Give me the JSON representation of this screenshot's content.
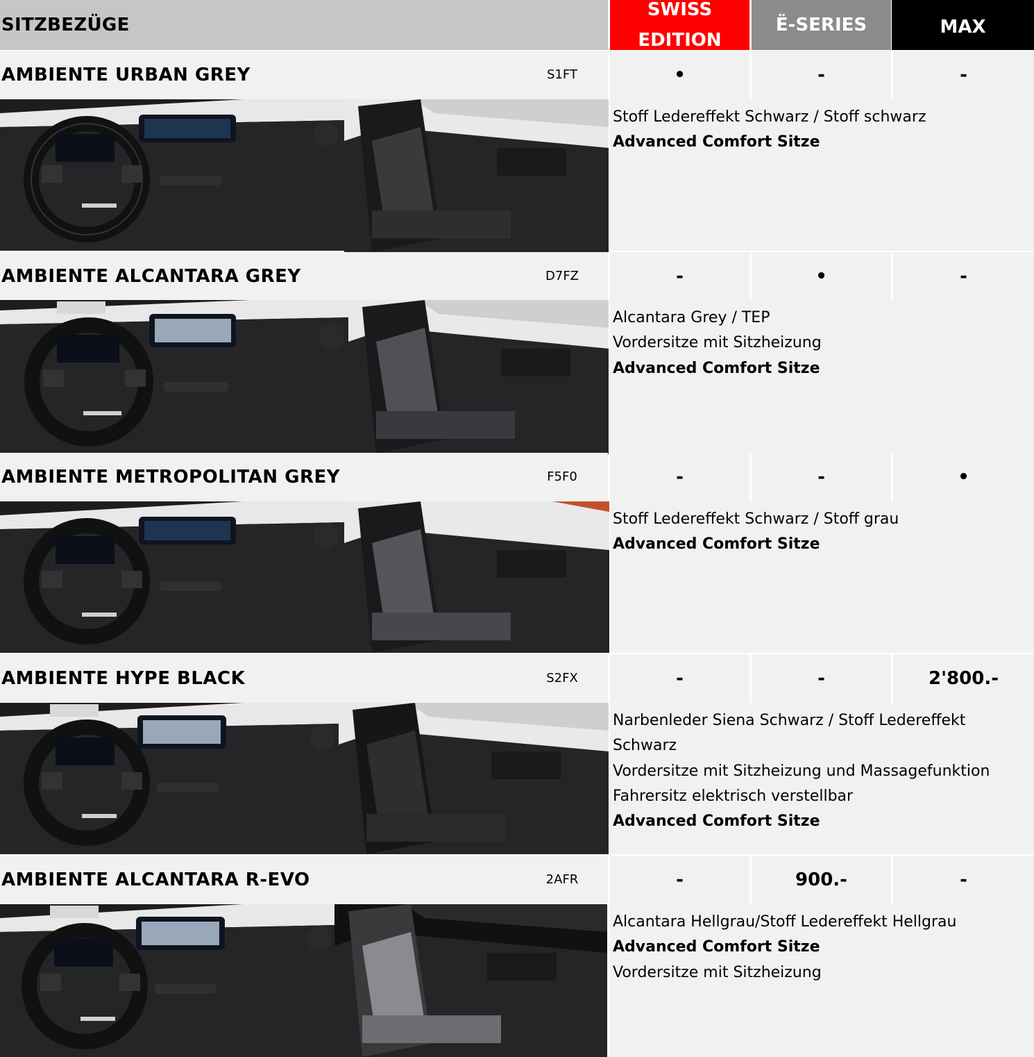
{
  "header": {
    "title": "SITZBEZÜGE",
    "columns": [
      "SWISS EDITION",
      "Ë-SERIES",
      "MAX"
    ],
    "colors": {
      "swiss": "#ff0000",
      "eseries": "#8c8c8c",
      "max": "#000000",
      "title_bg": "#c6c6c6"
    }
  },
  "rows": [
    {
      "name": "AMBIENTE URBAN GREY",
      "code": "S1FT",
      "values": [
        "•",
        "-",
        "-"
      ],
      "lines": [
        "Stoff Ledereffekt Schwarz / Stoff schwarz"
      ],
      "bold": "Advanced Comfort Sitze"
    },
    {
      "name": "AMBIENTE ALCANTARA GREY",
      "code": "D7FZ",
      "values": [
        "-",
        "•",
        "-"
      ],
      "lines": [
        "Alcantara Grey / TEP",
        "Vordersitze mit Sitzheizung"
      ],
      "bold": "Advanced Comfort Sitze"
    },
    {
      "name": "AMBIENTE METROPOLITAN GREY",
      "code": "F5F0",
      "values": [
        "-",
        "-",
        "•"
      ],
      "lines": [
        "Stoff Ledereffekt Schwarz / Stoff grau"
      ],
      "bold": "Advanced Comfort Sitze"
    },
    {
      "name": "AMBIENTE HYPE BLACK",
      "code": "S2FX",
      "values": [
        "-",
        "-",
        "2'800.-"
      ],
      "lines": [
        "Narbenleder Siena Schwarz / Stoff Ledereffekt",
        "Schwarz",
        "Vordersitze mit Sitzheizung und Massagefunktion",
        "Fahrersitz elektrisch verstellbar"
      ],
      "bold": "Advanced Comfort Sitze"
    },
    {
      "name": "AMBIENTE ALCANTARA R-EVO",
      "code": "2AFR",
      "values": [
        "-",
        "900.-",
        "-"
      ],
      "lines": [
        "Alcantara Hellgrau/Stoff Ledereffekt Hellgrau"
      ],
      "bold": "Advanced Comfort Sitze",
      "after": "Vordersitze mit Sitzheizung"
    }
  ]
}
